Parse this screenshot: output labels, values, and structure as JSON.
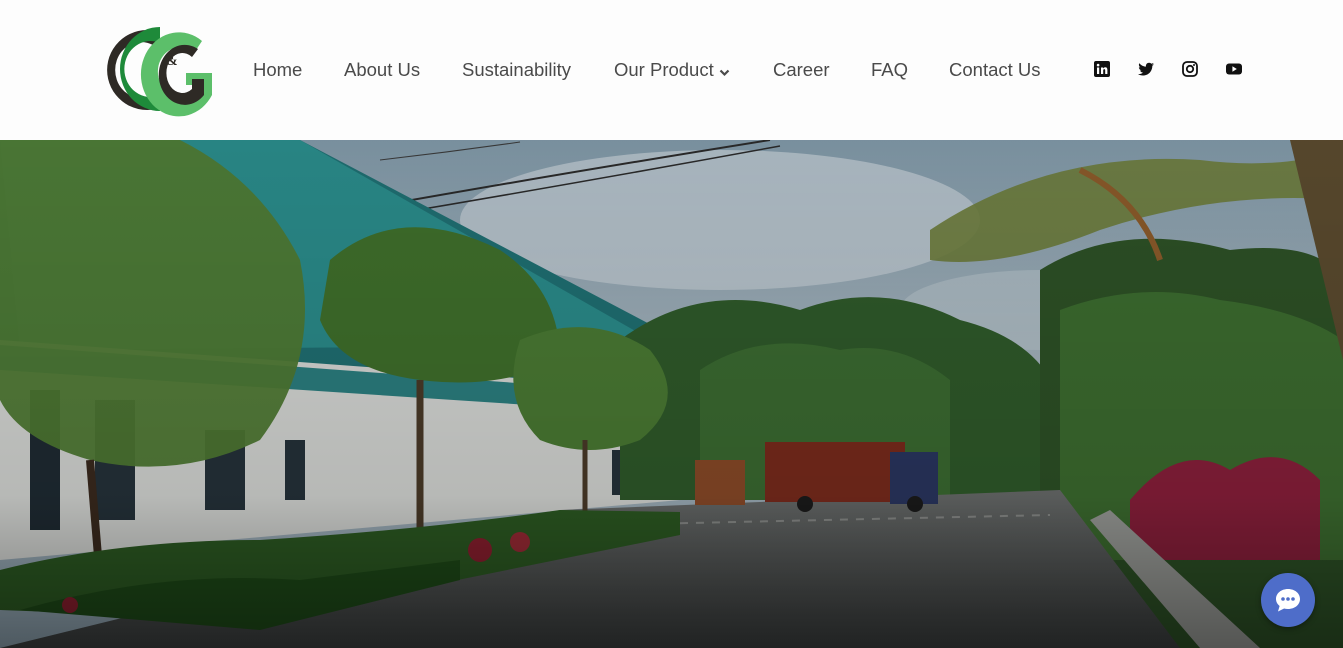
{
  "brand": {
    "logo_alt": "C&G",
    "logo_amp": "&"
  },
  "nav": {
    "items": [
      {
        "label": "Home"
      },
      {
        "label": "About Us"
      },
      {
        "label": "Sustainability"
      },
      {
        "label": "Our Product",
        "dropdown": true
      },
      {
        "label": "Career"
      },
      {
        "label": "FAQ"
      },
      {
        "label": "Contact Us"
      }
    ]
  },
  "social": [
    "linkedin-icon",
    "twitter-icon",
    "instagram-icon",
    "youtube-icon"
  ],
  "hero": {
    "scene": "factory-courtyard-photo"
  },
  "chat": {
    "icon": "chat-bubble-icon"
  },
  "colors": {
    "logo_green": "#5cbf6a",
    "logo_dark": "#2e2a25",
    "logo_deep_green": "#1e8a3a",
    "nav_text": "#4a4a4a",
    "chat_button": "#4e6dc9"
  }
}
